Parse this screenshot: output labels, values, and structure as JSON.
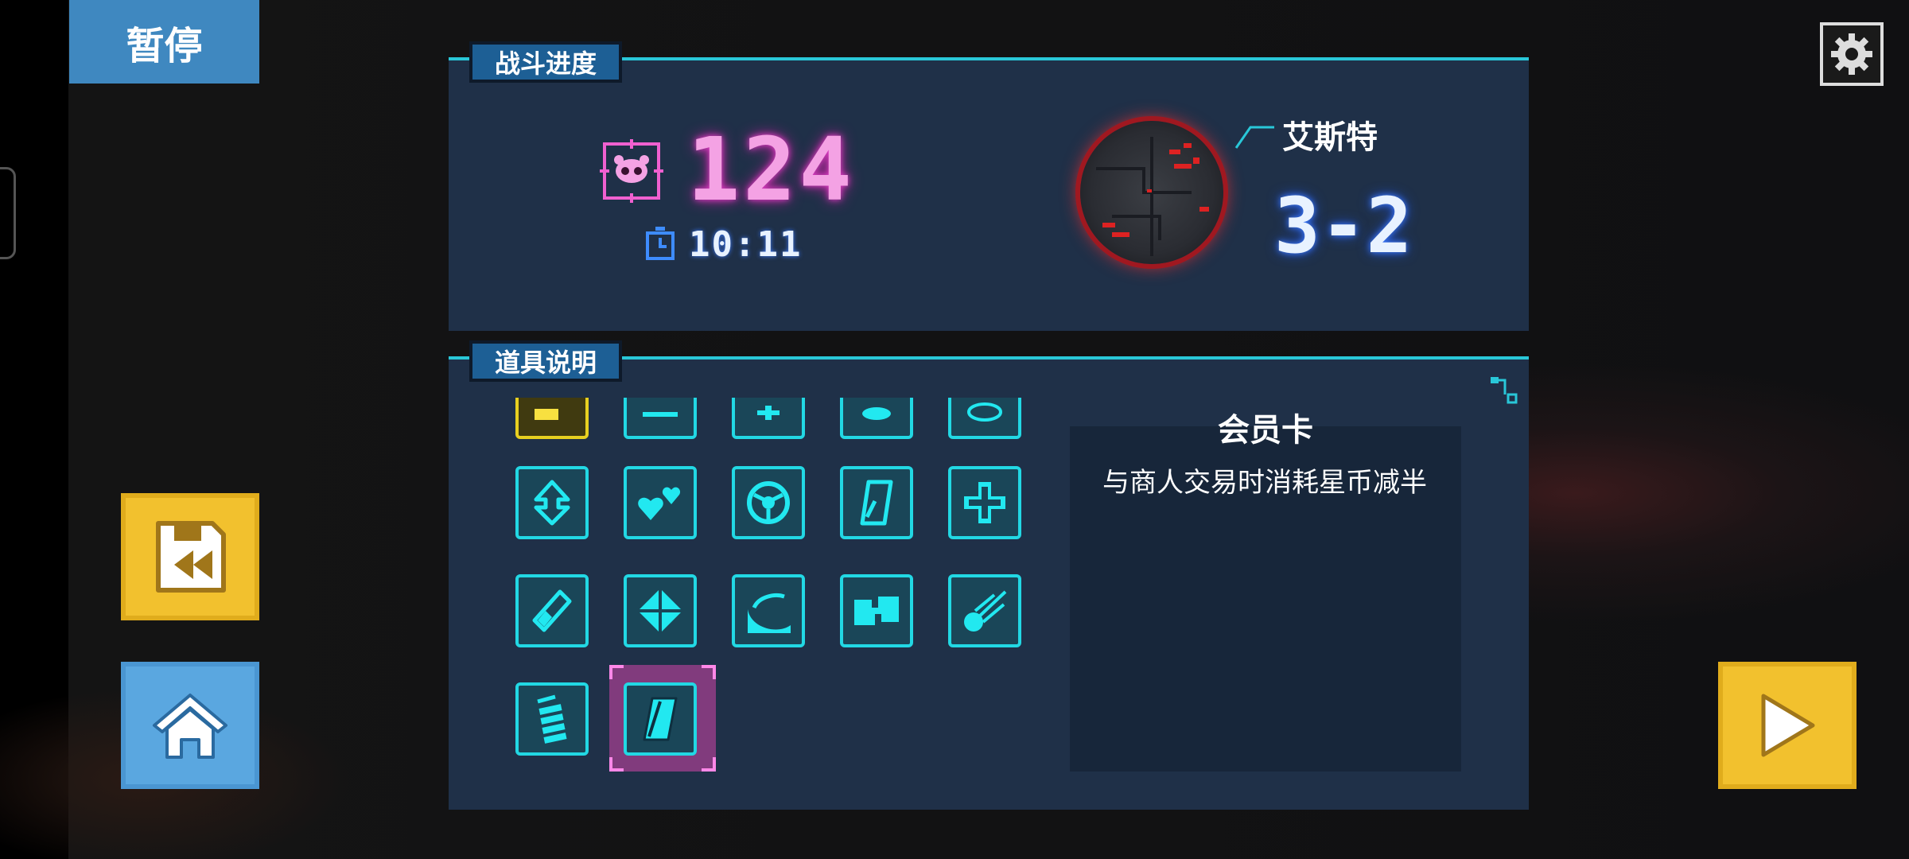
{
  "pause": {
    "title": "暂停"
  },
  "tabs": {
    "progress": "战斗进度",
    "items": "道具说明"
  },
  "progress": {
    "kills": "124",
    "time": "10:11",
    "stage_name": "艾斯特",
    "stage_level": "3-2"
  },
  "item_detail": {
    "name": "会员卡",
    "description": "与商人交易时消耗星币减半"
  },
  "items": [
    {
      "icon": "partial-yellow-item-icon"
    },
    {
      "icon": "partial-item-icon"
    },
    {
      "icon": "partial-item-icon"
    },
    {
      "icon": "partial-item-icon"
    },
    {
      "icon": "partial-item-icon"
    },
    {
      "icon": "upgrade-arrow-icon"
    },
    {
      "icon": "hearts-icon"
    },
    {
      "icon": "shield-circle-icon"
    },
    {
      "icon": "card-icon"
    },
    {
      "icon": "medical-cross-icon"
    },
    {
      "icon": "bandage-icon"
    },
    {
      "icon": "diamond-target-icon"
    },
    {
      "icon": "wave-icon"
    },
    {
      "icon": "puzzle-icon"
    },
    {
      "icon": "comet-icon"
    },
    {
      "icon": "battery-icon"
    },
    {
      "icon": "member-card-icon"
    }
  ],
  "selected_item_index": 16,
  "colors": {
    "accent": "#29c7d8",
    "kill_pink": "#f4a2e4",
    "button_yellow": "#f2c12e",
    "button_blue": "#5aa7e0",
    "pause_blue": "#3f88c0"
  }
}
